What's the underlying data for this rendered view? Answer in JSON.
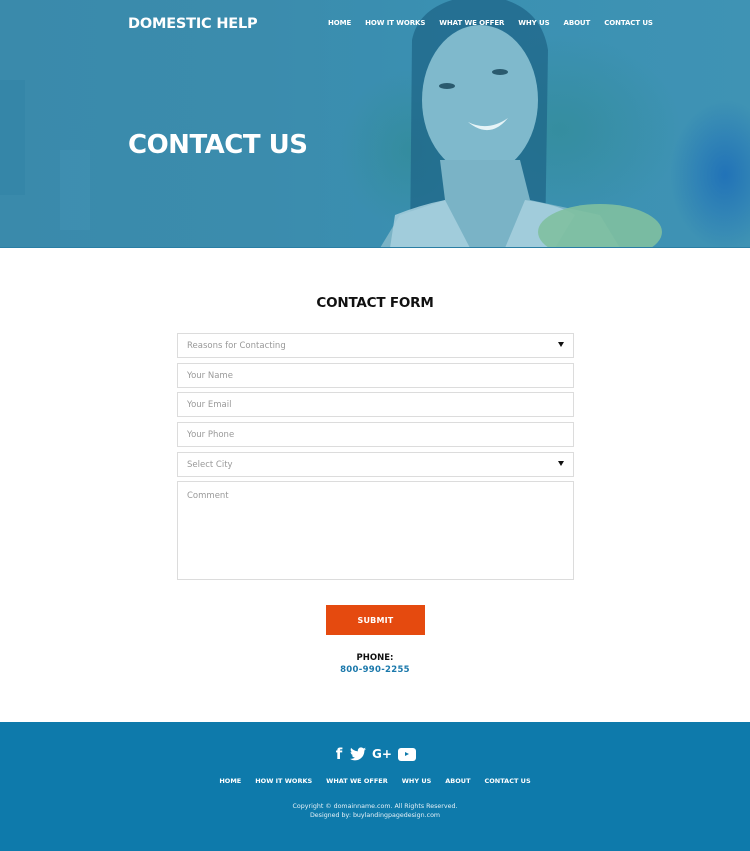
{
  "header": {
    "logo": "DOMESTIC HELP",
    "nav": [
      "HOME",
      "HOW IT WORKS",
      "WHAT WE OFFER",
      "WHY US",
      "ABOUT",
      "CONTACT US"
    ]
  },
  "hero": {
    "title": "CONTACT US",
    "overlay_color": "#3a8cae"
  },
  "form": {
    "title": "CONTACT FORM",
    "fields": {
      "reason": {
        "type": "select",
        "placeholder": "Reasons for Contacting"
      },
      "name": {
        "type": "text",
        "placeholder": "Your Name"
      },
      "email": {
        "type": "text",
        "placeholder": "Your Email"
      },
      "phone": {
        "type": "text",
        "placeholder": "Your Phone"
      },
      "city": {
        "type": "select",
        "placeholder": "Select City"
      },
      "comment": {
        "type": "textarea",
        "placeholder": "Comment"
      }
    },
    "submit_label": "SUBMIT",
    "submit_color": "#e54a0f"
  },
  "contact": {
    "phone_label": "PHONE:",
    "phone_number": "800-990-2255",
    "phone_color": "#1a78ab"
  },
  "footer": {
    "background": "#0e7aab",
    "social": [
      "facebook-icon",
      "twitter-icon",
      "google-plus-icon",
      "youtube-icon"
    ],
    "google_plus_text": "G+",
    "facebook_text": "f",
    "nav": [
      "HOME",
      "HOW IT WORKS",
      "WHAT WE OFFER",
      "WHY US",
      "ABOUT",
      "CONTACT US"
    ],
    "copyright": "Copyright © domainname.com. All Rights Reserved.",
    "designed_by": "Designed by: buylandingpagedesign.com"
  }
}
